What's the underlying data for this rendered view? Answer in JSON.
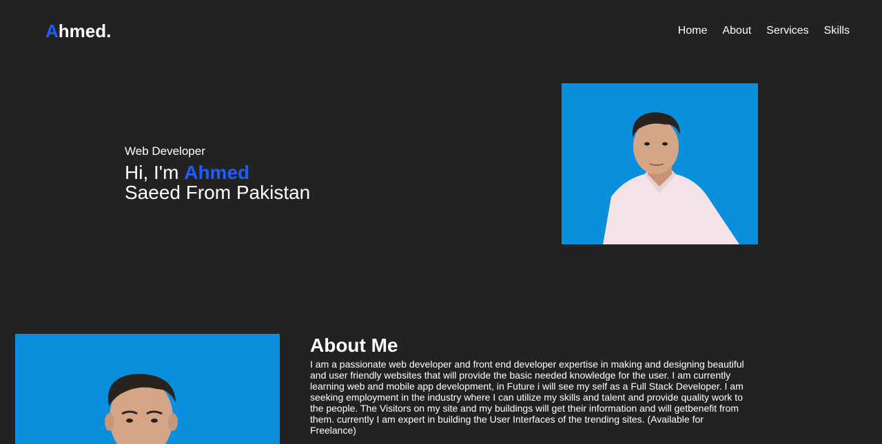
{
  "header": {
    "logo_initial": "A",
    "logo_rest": "hmed.",
    "nav": [
      {
        "label": "Home"
      },
      {
        "label": "About"
      },
      {
        "label": "Services"
      },
      {
        "label": "Skills"
      }
    ]
  },
  "hero": {
    "subtitle": "Web Developer",
    "greeting": "Hi, I'm",
    "name": "Ahmed",
    "line2": "Saeed From Pakistan",
    "photo_background": "#0a8fdd"
  },
  "about": {
    "title": "About Me",
    "body": "I am a passionate web developer and front end developer expertise in making and designing beautiful and user friendly websites that will provide the basic needed knowledge for the user. I am currently learning web and mobile app development, in Future i will see my self as a Full Stack Developer. I am seeking employment in the industry where I can utilize my skills and talent and provide quality work to the people. The Visitors on my site and my buildings will get their information and will getbenefit from them. currently I am expert in building the User Interfaces of the trending sites. (Available for Freelance)"
  },
  "colors": {
    "background": "#222222",
    "accent": "#1e5eff",
    "text": "#ffffff",
    "photo_bg": "#0a8fdd"
  }
}
